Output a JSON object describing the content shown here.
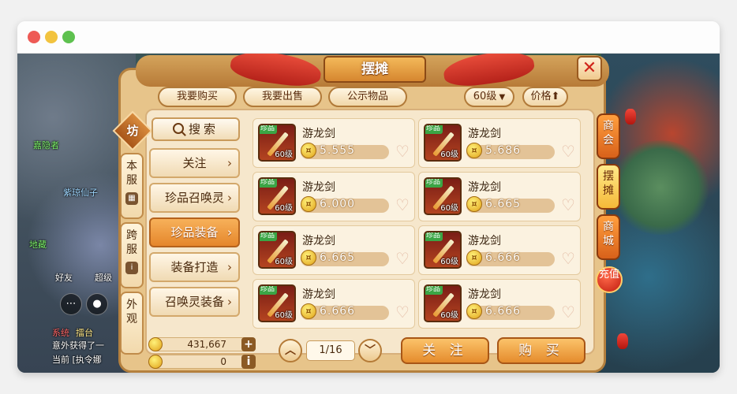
{
  "window": {
    "controls": [
      "close",
      "minimize",
      "maximize"
    ]
  },
  "game": {
    "title": "摆摊",
    "close_label": "✕",
    "top_tabs": [
      {
        "label": "我要购买"
      },
      {
        "label": "我要出售"
      },
      {
        "label": "公示物品"
      }
    ],
    "level_filter": "60级",
    "sort_label": "价格",
    "server_badge": "坊",
    "server_tabs": [
      {
        "label": "本服"
      },
      {
        "label": "跨服"
      },
      {
        "label": "外观"
      }
    ],
    "search_label": "搜索",
    "categories": [
      {
        "label": "关注",
        "active": false
      },
      {
        "label": "珍品召唤灵",
        "active": false
      },
      {
        "label": "珍品装备",
        "active": true
      },
      {
        "label": "装备打造",
        "active": false
      },
      {
        "label": "召唤灵装备",
        "active": false
      }
    ],
    "items": [
      {
        "name": "游龙剑",
        "tag": "珍品",
        "level": "60级",
        "price": "5.555"
      },
      {
        "name": "游龙剑",
        "tag": "珍品",
        "level": "60级",
        "price": "5.686"
      },
      {
        "name": "游龙剑",
        "tag": "珍品",
        "level": "60级",
        "price": "6.000"
      },
      {
        "name": "游龙剑",
        "tag": "珍品",
        "level": "60级",
        "price": "6.665"
      },
      {
        "name": "游龙剑",
        "tag": "珍品",
        "level": "60级",
        "price": "6.665"
      },
      {
        "name": "游龙剑",
        "tag": "珍品",
        "level": "60级",
        "price": "6.666"
      },
      {
        "name": "游龙剑",
        "tag": "珍品",
        "level": "60级",
        "price": "6.666"
      },
      {
        "name": "游龙剑",
        "tag": "珍品",
        "level": "60级",
        "price": "6.666"
      }
    ],
    "wallet": {
      "coins": "431,667",
      "other": "0"
    },
    "pager": {
      "current": "1/16"
    },
    "actions": {
      "follow": "关 注",
      "buy": "购 买"
    },
    "side_tabs": [
      {
        "label": "商会",
        "active": false
      },
      {
        "label": "摆摊",
        "active": true
      },
      {
        "label": "商城",
        "active": false
      }
    ],
    "recharge_label": "充值",
    "hud": {
      "chat_lines": [
        "意外获得了一",
        "当前 [执令娜"
      ],
      "labels": [
        "好友",
        "超级",
        "擂台"
      ]
    },
    "colors": {
      "panel": "#e7c48a",
      "active_tab": "#e5862b",
      "tag_green": "#3ba545",
      "close_red": "#d0241a"
    },
    "icons": [
      "search-icon",
      "heart-icon",
      "coin-icon",
      "sword-icon",
      "chevron-right-icon",
      "plus-icon",
      "info-icon"
    ]
  }
}
